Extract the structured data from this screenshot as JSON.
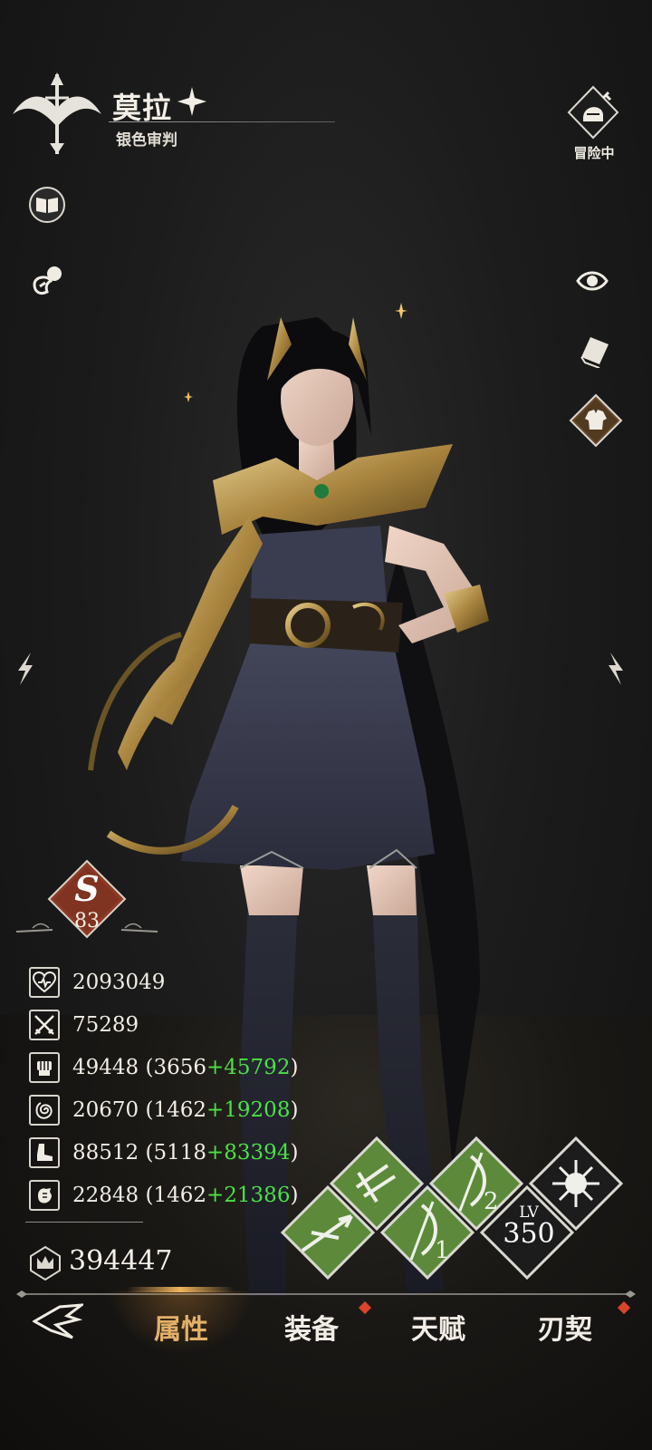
{
  "header": {
    "name": "莫拉",
    "title": "银色审判",
    "status_label": "冒险中"
  },
  "icons": {
    "class": "bow-crest-icon",
    "star": "star-icon",
    "book": "book-icon",
    "pet": "pet-icon",
    "adventure": "knight-helmet-icon",
    "visibility": "eye-icon",
    "card": "card-icon",
    "outfit": "outfit-icon"
  },
  "rank": {
    "letter": "S",
    "number": "83"
  },
  "stats": [
    {
      "icon": "heart-icon",
      "value": "2093049",
      "base": "",
      "bonus": ""
    },
    {
      "icon": "crossed-swords-icon",
      "value": "75289",
      "base": "",
      "bonus": ""
    },
    {
      "icon": "fist-icon",
      "value": "49448",
      "base": "3656",
      "bonus": "+45792"
    },
    {
      "icon": "spiral-icon",
      "value": "20670",
      "base": "1462",
      "bonus": "+19208"
    },
    {
      "icon": "boot-icon",
      "value": "88512",
      "base": "5118",
      "bonus": "+83394"
    },
    {
      "icon": "hand-icon",
      "value": "22848",
      "base": "1462",
      "bonus": "+21386"
    }
  ],
  "power": "394447",
  "skills": {
    "slot1_label": "1",
    "slot2_label": "2",
    "lv_label": "LV",
    "lv_value": "350"
  },
  "tabs": {
    "attributes": "属性",
    "equipment": "装备",
    "talent": "天赋",
    "pact": "刃契"
  },
  "colors": {
    "accent_gold": "#e3b06a",
    "bonus_green": "#4ce046",
    "rank_red": "#8c3a26",
    "skill_green": "#5c8a3a",
    "notify_red": "#d9442b"
  }
}
